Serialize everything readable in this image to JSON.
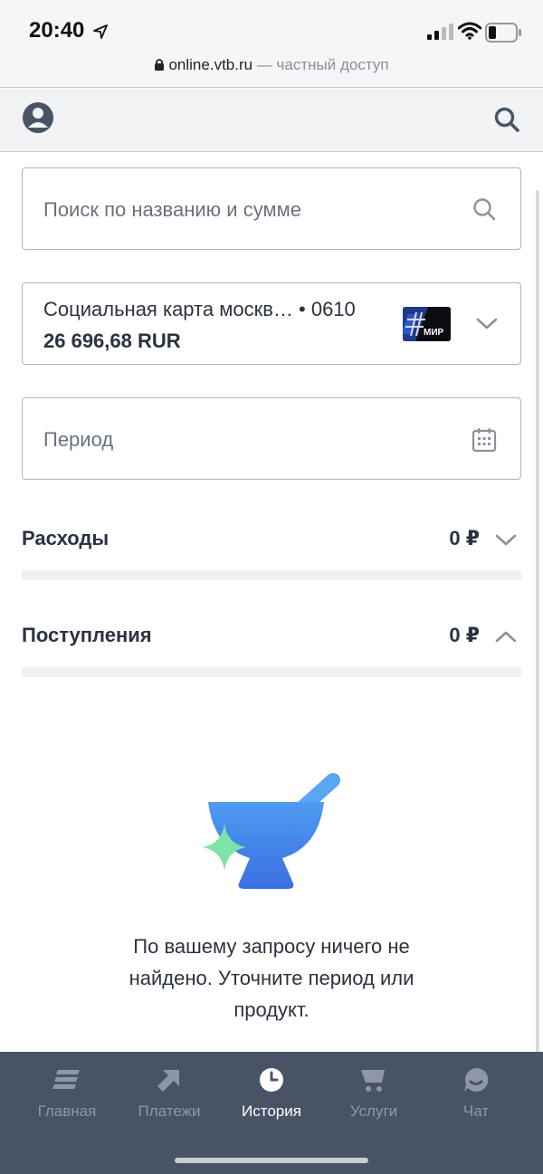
{
  "status_bar": {
    "time": "20:40",
    "url_domain": "online.vtb.ru",
    "url_suffix": " — частный доступ"
  },
  "header": {
    "profile_icon": "profile-icon",
    "search_icon": "search-icon"
  },
  "search": {
    "placeholder": "Поиск по названию и сумме"
  },
  "card": {
    "name": "Социальная карта москв… • 0610",
    "balance": "26 696,68 RUR",
    "payment_system": "МИР"
  },
  "period": {
    "placeholder": "Период"
  },
  "sections": {
    "expenses": {
      "title": "Расходы",
      "amount": "0 ₽"
    },
    "income": {
      "title": "Поступления",
      "amount": "0 ₽"
    }
  },
  "empty_state": {
    "message": "По вашему запросу ничего не найдено. Уточните период или продукт."
  },
  "bottom_nav": {
    "items": [
      {
        "label": "Главная",
        "icon": "home-icon"
      },
      {
        "label": "Платежи",
        "icon": "payments-arrow-icon"
      },
      {
        "label": "История",
        "icon": "history-clock-icon",
        "active": true
      },
      {
        "label": "Услуги",
        "icon": "cart-icon"
      },
      {
        "label": "Чат",
        "icon": "chat-icon"
      }
    ]
  },
  "colors": {
    "nav_background": "#485466",
    "accent_blue": "#4a8ff0",
    "sparkle_green": "#7ee3a6"
  }
}
